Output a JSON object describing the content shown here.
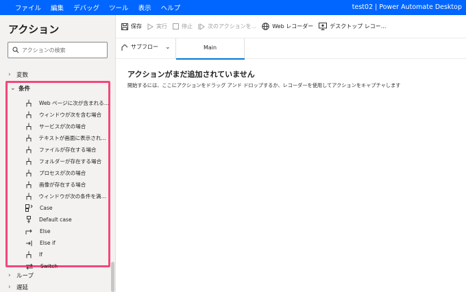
{
  "menu": [
    "ファイル",
    "編集",
    "デバッグ",
    "ツール",
    "表示",
    "ヘルプ"
  ],
  "window_title": "test02 | Power Automate Desktop",
  "panel": {
    "title": "アクション",
    "search_placeholder": "アクションの検索"
  },
  "categories": {
    "variables": "変数",
    "conditionals": "条件",
    "loops": "ループ",
    "wait": "遅延"
  },
  "conditional_actions": [
    {
      "label": "Web ページに次が含まれる...",
      "icon": "branch-icon"
    },
    {
      "label": "ウィンドウが次を含む場合",
      "icon": "branch-icon"
    },
    {
      "label": "サービスが次の場合",
      "icon": "branch-icon"
    },
    {
      "label": "テキストが画面に表示される...",
      "icon": "branch-icon"
    },
    {
      "label": "ファイルが存在する場合",
      "icon": "branch-icon"
    },
    {
      "label": "フォルダーが存在する場合",
      "icon": "branch-icon"
    },
    {
      "label": "プロセスが次の場合",
      "icon": "branch-icon"
    },
    {
      "label": "画像が存在する場合",
      "icon": "branch-icon"
    },
    {
      "label": "ウィンドウが次の条件を満た...",
      "icon": "branch-icon"
    },
    {
      "label": "Case",
      "icon": "case-icon"
    },
    {
      "label": "Default case",
      "icon": "default-case-icon"
    },
    {
      "label": "Else",
      "icon": "else-icon"
    },
    {
      "label": "Else if",
      "icon": "else-if-icon"
    },
    {
      "label": "If",
      "icon": "branch-icon"
    },
    {
      "label": "Switch",
      "icon": "switch-icon"
    }
  ],
  "toolbar": {
    "save": "保存",
    "run": "実行",
    "stop": "停止",
    "next_action": "次のアクションを...",
    "web_recorder": "Web レコーダー",
    "desktop_recorder": "デスクトップ レコー..."
  },
  "tabs": {
    "subflows": "サブフロー",
    "main": "Main"
  },
  "empty_state": {
    "title": "アクションがまだ追加されていません",
    "description": "開始するには、ここにアクションをドラッグ アンド ドロップするか、レコーダーを使用してアクションをキャプチャします"
  },
  "colors": {
    "title_bar": "#0066ff",
    "highlight_border": "#f4467a",
    "accent": "#0078d4"
  }
}
